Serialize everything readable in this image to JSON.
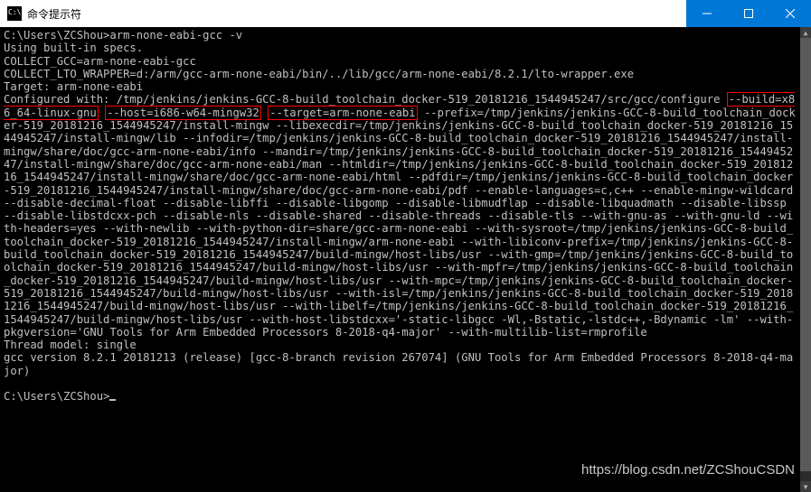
{
  "window": {
    "title": "命令提示符"
  },
  "terminal": {
    "line01": "C:\\Users\\ZCShou>arm-none-eabi-gcc -v",
    "line02": "Using built-in specs.",
    "line03": "COLLECT_GCC=arm-none-eabi-gcc",
    "line04": "COLLECT_LTO_WRAPPER=d:/arm/gcc-arm-none-eabi/bin/../lib/gcc/arm-none-eabi/8.2.1/lto-wrapper.exe",
    "line05": "Target: arm-none-eabi",
    "cfg_pre": "Configured with: /tmp/jenkins/jenkins-GCC-8-build_toolchain_docker-519_20181216_1544945247/src/gcc/configure ",
    "hl1": "--build=x86_64-linux-gnu",
    "cfg_sp1": " ",
    "hl2": "--host=i686-w64-mingw32",
    "cfg_sp2": " ",
    "hl3": "--target=arm-none-eabi",
    "cfg_post": " --prefix=/tmp/jenkins/jenkins-GCC-8-build_toolchain_docker-519_20181216_1544945247/install-mingw --libexecdir=/tmp/jenkins/jenkins-GCC-8-build_toolchain_docker-519_20181216_1544945247/install-mingw/lib --infodir=/tmp/jenkins/jenkins-GCC-8-build_toolchain_docker-519_20181216_1544945247/install-mingw/share/doc/gcc-arm-none-eabi/info --mandir=/tmp/jenkins/jenkins-GCC-8-build_toolchain_docker-519_20181216_1544945247/install-mingw/share/doc/gcc-arm-none-eabi/man --htmldir=/tmp/jenkins/jenkins-GCC-8-build_toolchain_docker-519_20181216_1544945247/install-mingw/share/doc/gcc-arm-none-eabi/html --pdfdir=/tmp/jenkins/jenkins-GCC-8-build_toolchain_docker-519_20181216_1544945247/install-mingw/share/doc/gcc-arm-none-eabi/pdf --enable-languages=c,c++ --enable-mingw-wildcard --disable-decimal-float --disable-libffi --disable-libgomp --disable-libmudflap --disable-libquadmath --disable-libssp --disable-libstdcxx-pch --disable-nls --disable-shared --disable-threads --disable-tls --with-gnu-as --with-gnu-ld --with-headers=yes --with-newlib --with-python-dir=share/gcc-arm-none-eabi --with-sysroot=/tmp/jenkins/jenkins-GCC-8-build_toolchain_docker-519_20181216_1544945247/install-mingw/arm-none-eabi --with-libiconv-prefix=/tmp/jenkins/jenkins-GCC-8-build_toolchain_docker-519_20181216_1544945247/build-mingw/host-libs/usr --with-gmp=/tmp/jenkins/jenkins-GCC-8-build_toolchain_docker-519_20181216_1544945247/build-mingw/host-libs/usr --with-mpfr=/tmp/jenkins/jenkins-GCC-8-build_toolchain_docker-519_20181216_1544945247/build-mingw/host-libs/usr --with-mpc=/tmp/jenkins/jenkins-GCC-8-build_toolchain_docker-519_20181216_1544945247/build-mingw/host-libs/usr --with-isl=/tmp/jenkins/jenkins-GCC-8-build_toolchain_docker-519_20181216_1544945247/build-mingw/host-libs/usr --with-libelf=/tmp/jenkins/jenkins-GCC-8-build_toolchain_docker-519_20181216_1544945247/build-mingw/host-libs/usr --with-host-libstdcxx='-static-libgcc -Wl,-Bstatic,-lstdc++,-Bdynamic -lm' --with-pkgversion='GNU Tools for Arm Embedded Processors 8-2018-q4-major' --with-multilib-list=rmprofile",
    "line_thread": "Thread model: single",
    "line_ver": "gcc version 8.2.1 20181213 (release) [gcc-8-branch revision 267074] (GNU Tools for Arm Embedded Processors 8-2018-q4-major)",
    "prompt": "C:\\Users\\ZCShou>"
  },
  "watermark": "https://blog.csdn.net/ZCShouCSDN"
}
